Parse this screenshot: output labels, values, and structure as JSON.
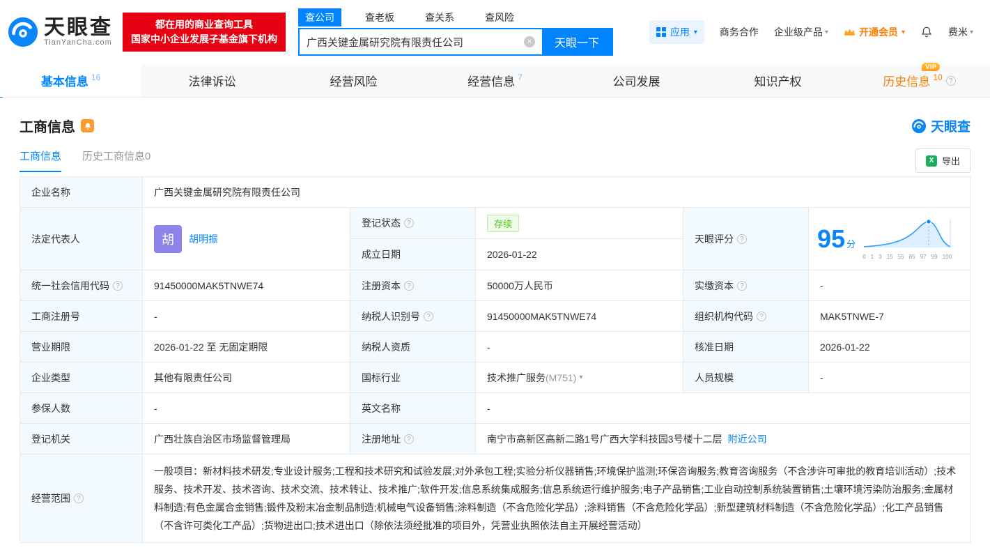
{
  "icons": {
    "help": "?",
    "chevron": "▾",
    "clear": "×",
    "excel": "X"
  },
  "colors": {
    "primary": "#0084ff",
    "promo_red": "#e60012",
    "label_bg": "#f2f9ff",
    "status_green": "#52c41a",
    "history_orange": "#ff8000",
    "avatar_purple": "#8d83ea"
  },
  "header": {
    "logo": {
      "cn": "天眼查",
      "en": "TianYanCha.com"
    },
    "promo": {
      "line1": "都在用的商业查询工具",
      "line2": "国家中小企业发展子基金旗下机构"
    },
    "search": {
      "tabs": [
        {
          "label": "查公司"
        },
        {
          "label": "查老板"
        },
        {
          "label": "查关系"
        },
        {
          "label": "查风险"
        }
      ],
      "value": "广西关键金属研究院有限责任公司",
      "button": "天眼一下"
    },
    "menu": {
      "apps": "应用",
      "cooperation": "商务合作",
      "enterprise": "企业级产品",
      "vip": "开通会员",
      "user": "费米"
    }
  },
  "nav": {
    "vip_badge": "VIP",
    "tabs": [
      {
        "label": "基本信息",
        "count": "16"
      },
      {
        "label": "法律诉讼",
        "count": ""
      },
      {
        "label": "经营风险",
        "count": ""
      },
      {
        "label": "经营信息",
        "count": "7"
      },
      {
        "label": "公司发展",
        "count": ""
      },
      {
        "label": "知识产权",
        "count": ""
      },
      {
        "label": "历史信息",
        "count": "10"
      }
    ]
  },
  "section": {
    "title": "工商信息",
    "brand": "天眼查",
    "subtab_active": "工商信息",
    "subtab_history": "历史工商信息0",
    "export": "导出"
  },
  "score_axis": [
    "0",
    "1",
    "3",
    "15",
    "55",
    "85",
    "97",
    "99",
    "100"
  ],
  "info": {
    "company_name": {
      "label": "企业名称",
      "value": "广西关键金属研究院有限责任公司"
    },
    "legal_rep": {
      "label": "法定代表人",
      "avatar": "胡",
      "name": "胡明振"
    },
    "reg_status": {
      "label": "登记状态",
      "value": "存续"
    },
    "establish_date": {
      "label": "成立日期",
      "value": "2026-01-22"
    },
    "score": {
      "label": "天眼评分",
      "value": "95",
      "unit": "分"
    },
    "credit_code": {
      "label": "统一社会信用代码",
      "value": "91450000MAK5TNWE74"
    },
    "reg_capital": {
      "label": "注册资本",
      "value": "50000万人民币"
    },
    "paid_capital": {
      "label": "实缴资本",
      "value": "-"
    },
    "reg_number": {
      "label": "工商注册号",
      "value": "-"
    },
    "taxpayer_id": {
      "label": "纳税人识别号",
      "value": "91450000MAK5TNWE74"
    },
    "org_code": {
      "label": "组织机构代码",
      "value": "MAK5TNWE-7"
    },
    "business_term": {
      "label": "营业期限",
      "value": "2026-01-22 至 无固定期限"
    },
    "taxpayer_quality": {
      "label": "纳税人资质",
      "value": "-"
    },
    "approval_date": {
      "label": "核准日期",
      "value": "2026-01-22"
    },
    "company_type": {
      "label": "企业类型",
      "value": "其他有限责任公司"
    },
    "industry": {
      "label": "国标行业",
      "value": "技术推广服务",
      "suffix": "(M751)"
    },
    "staff_size": {
      "label": "人员规模",
      "value": "-"
    },
    "insured_count": {
      "label": "参保人数",
      "value": "-"
    },
    "english_name": {
      "label": "英文名称",
      "value": "-"
    },
    "reg_authority": {
      "label": "登记机关",
      "value": "广西壮族自治区市场监督管理局"
    },
    "reg_address": {
      "label": "注册地址",
      "value": "南宁市高新区高新二路1号广西大学科技园3号楼十二层",
      "link": "附近公司"
    },
    "business_scope": {
      "label": "经营范围",
      "value": "一般项目：新材料技术研发;专业设计服务;工程和技术研究和试验发展;对外承包工程;实验分析仪器销售;环境保护监测;环保咨询服务;教育咨询服务（不含涉许可审批的教育培训活动）;技术服务、技术开发、技术咨询、技术交流、技术转让、技术推广;软件开发;信息系统集成服务;信息系统运行维护服务;电子产品销售;工业自动控制系统装置销售;土壤环境污染防治服务;金属材料制造;有色金属合金销售;锻件及粉末冶金制品制造;机械电气设备销售;涂料制造（不含危险化学品）;涂料销售（不含危险化学品）;新型建筑材料制造（不含危险化学品）;化工产品销售（不含许可类化工产品）;货物进出口;技术进出口（除依法须经批准的项目外，凭营业执照依法自主开展经营活动）"
    }
  }
}
